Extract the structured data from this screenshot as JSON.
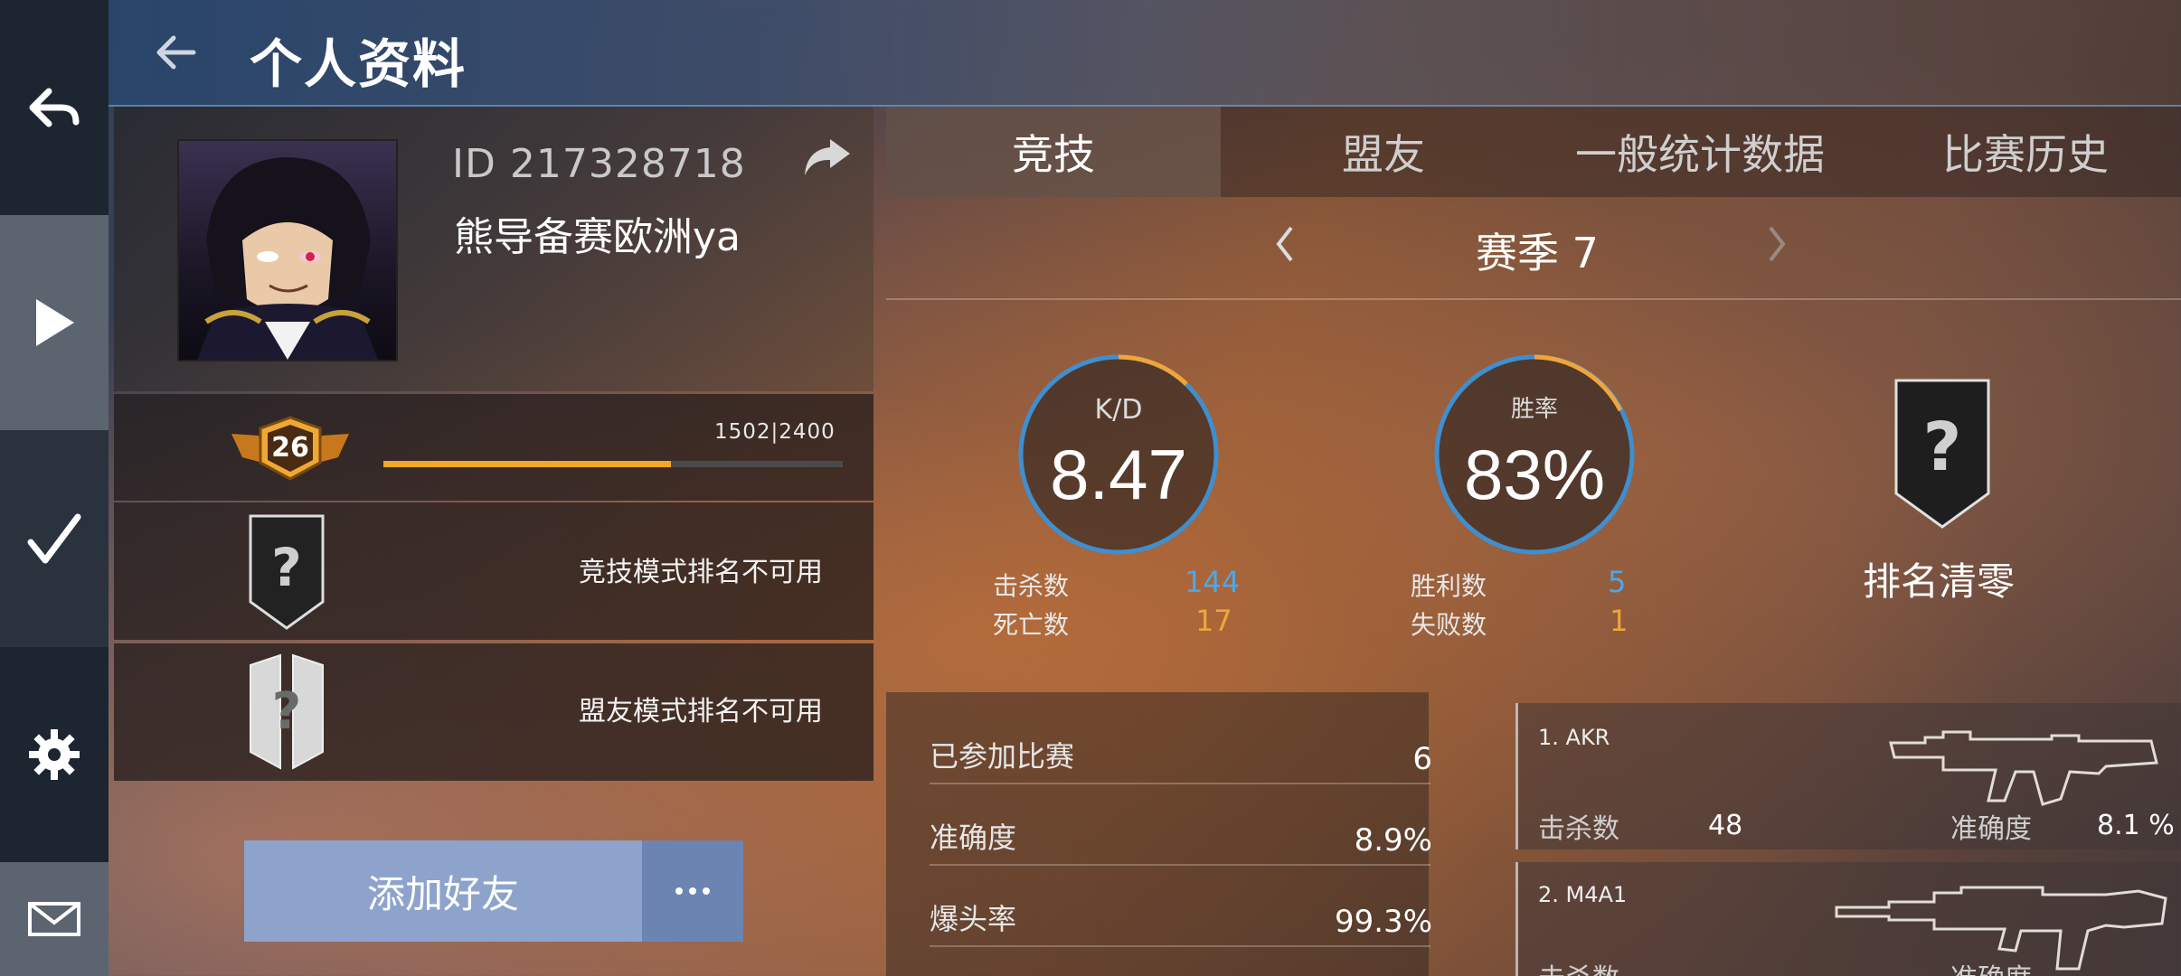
{
  "header": {
    "title": "个人资料"
  },
  "profile": {
    "id_text": "ID 217328718",
    "name": "熊导备赛欧洲ya",
    "level": "26",
    "xp_text": "1502|2400",
    "xp_progress": 0.626,
    "competitive_rank_text": "竞技模式排名不可用",
    "ally_rank_text": "盟友模式排名不可用",
    "add_friend_label": "添加好友"
  },
  "tabs": [
    {
      "label": "竞技",
      "active": true
    },
    {
      "label": "盟友",
      "active": false
    },
    {
      "label": "一般统计数据",
      "active": false
    },
    {
      "label": "比赛历史",
      "active": false
    }
  ],
  "season": {
    "label": "赛季 7"
  },
  "kd": {
    "label": "K/D",
    "value": "8.47",
    "kills_label": "击杀数",
    "kills": "144",
    "deaths_label": "死亡数",
    "deaths": "17"
  },
  "winrate": {
    "label": "胜率",
    "value": "83%",
    "wins_label": "胜利数",
    "wins": "5",
    "losses_label": "失败数",
    "losses": "1"
  },
  "rank_reset": {
    "badge": "?",
    "label": "排名清零"
  },
  "summary": [
    {
      "label": "已参加比赛",
      "value": "6"
    },
    {
      "label": "准确度",
      "value": "8.9%"
    },
    {
      "label": "爆头率",
      "value": "99.3%"
    }
  ],
  "weapons": [
    {
      "name": "1. AKR",
      "kills_label": "击杀数",
      "kills": "48",
      "accuracy_label": "准确度",
      "accuracy": "8.1 %"
    },
    {
      "name": "2. M4A1",
      "kills_label": "击杀数",
      "kills": "",
      "accuracy_label": "准确度",
      "accuracy": ""
    }
  ],
  "colors": {
    "accent_orange": "#f1a728",
    "accent_blue": "#4ea7e8",
    "button_blue": "#8ea3cc"
  }
}
